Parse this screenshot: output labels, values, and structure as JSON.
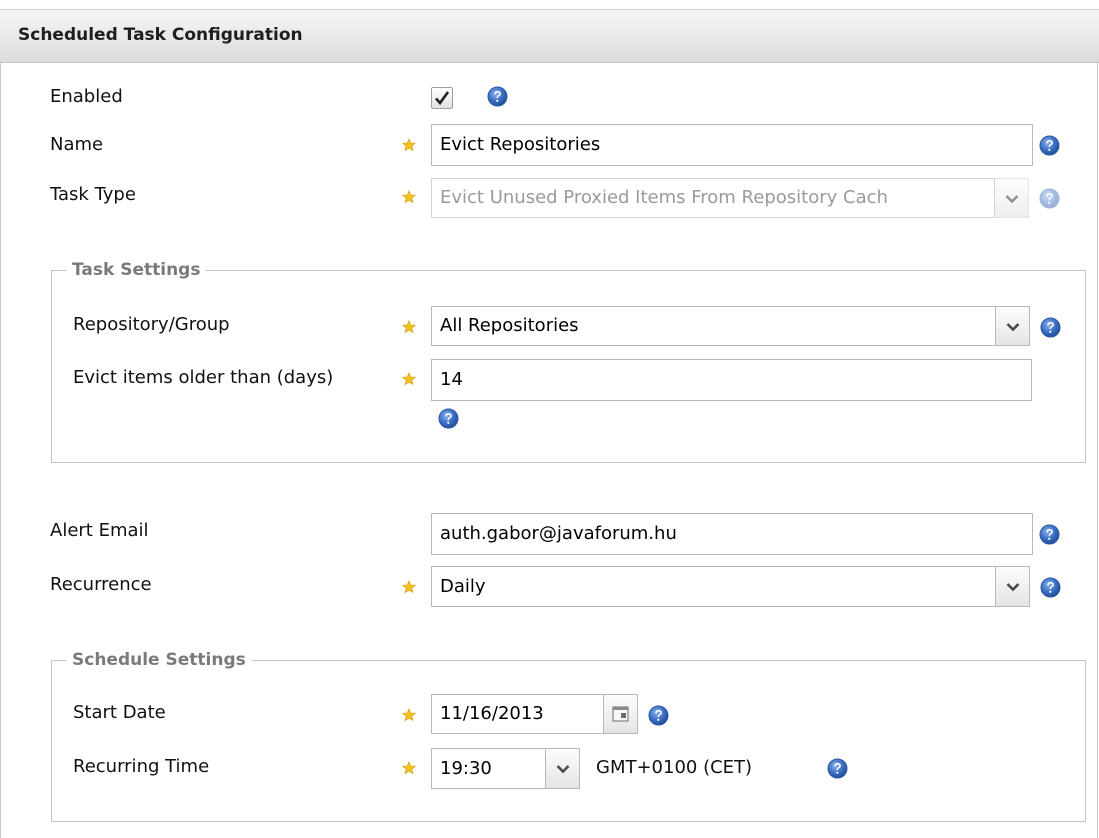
{
  "panel": {
    "title": "Scheduled Task Configuration"
  },
  "fields": {
    "enabled": {
      "label": "Enabled",
      "checked": true
    },
    "name": {
      "label": "Name",
      "value": "Evict Repositories"
    },
    "task_type": {
      "label": "Task Type",
      "value": "Evict Unused Proxied Items From Repository Cach"
    },
    "alert_email": {
      "label": "Alert Email",
      "value": "auth.gabor@javaforum.hu"
    },
    "recurrence": {
      "label": "Recurrence",
      "value": "Daily"
    }
  },
  "task_settings": {
    "legend": "Task Settings",
    "repository_group": {
      "label": "Repository/Group",
      "value": "All Repositories"
    },
    "evict_days": {
      "label": "Evict items older than (days)",
      "value": "14"
    }
  },
  "schedule_settings": {
    "legend": "Schedule Settings",
    "start_date": {
      "label": "Start Date",
      "value": "11/16/2013"
    },
    "recurring_time": {
      "label": "Recurring Time",
      "value": "19:30",
      "timezone": "GMT+0100 (CET)"
    }
  },
  "colors": {
    "help_blue": "#3a6fc4",
    "star_gold": "#f2c11c",
    "header_bg": "#e6e6e6"
  },
  "icons": {
    "help": "help-icon",
    "required": "required-star-icon",
    "calendar": "calendar-icon",
    "dropdown": "chevron-down-icon",
    "check": "check-icon"
  }
}
